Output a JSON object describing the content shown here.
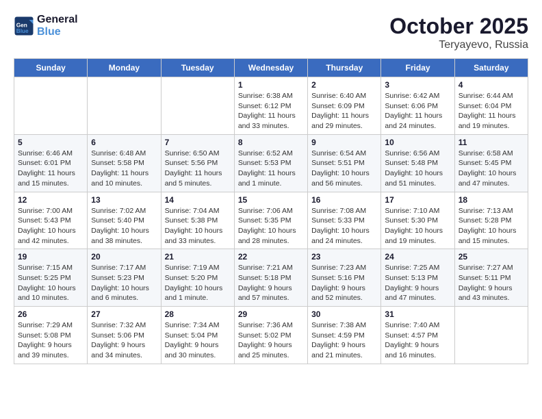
{
  "logo": {
    "line1": "General",
    "line2": "Blue"
  },
  "header": {
    "month": "October 2025",
    "location": "Teryayevo, Russia"
  },
  "weekdays": [
    "Sunday",
    "Monday",
    "Tuesday",
    "Wednesday",
    "Thursday",
    "Friday",
    "Saturday"
  ],
  "weeks": [
    [
      {
        "day": "",
        "info": ""
      },
      {
        "day": "",
        "info": ""
      },
      {
        "day": "",
        "info": ""
      },
      {
        "day": "1",
        "info": "Sunrise: 6:38 AM\nSunset: 6:12 PM\nDaylight: 11 hours\nand 33 minutes."
      },
      {
        "day": "2",
        "info": "Sunrise: 6:40 AM\nSunset: 6:09 PM\nDaylight: 11 hours\nand 29 minutes."
      },
      {
        "day": "3",
        "info": "Sunrise: 6:42 AM\nSunset: 6:06 PM\nDaylight: 11 hours\nand 24 minutes."
      },
      {
        "day": "4",
        "info": "Sunrise: 6:44 AM\nSunset: 6:04 PM\nDaylight: 11 hours\nand 19 minutes."
      }
    ],
    [
      {
        "day": "5",
        "info": "Sunrise: 6:46 AM\nSunset: 6:01 PM\nDaylight: 11 hours\nand 15 minutes."
      },
      {
        "day": "6",
        "info": "Sunrise: 6:48 AM\nSunset: 5:58 PM\nDaylight: 11 hours\nand 10 minutes."
      },
      {
        "day": "7",
        "info": "Sunrise: 6:50 AM\nSunset: 5:56 PM\nDaylight: 11 hours\nand 5 minutes."
      },
      {
        "day": "8",
        "info": "Sunrise: 6:52 AM\nSunset: 5:53 PM\nDaylight: 11 hours\nand 1 minute."
      },
      {
        "day": "9",
        "info": "Sunrise: 6:54 AM\nSunset: 5:51 PM\nDaylight: 10 hours\nand 56 minutes."
      },
      {
        "day": "10",
        "info": "Sunrise: 6:56 AM\nSunset: 5:48 PM\nDaylight: 10 hours\nand 51 minutes."
      },
      {
        "day": "11",
        "info": "Sunrise: 6:58 AM\nSunset: 5:45 PM\nDaylight: 10 hours\nand 47 minutes."
      }
    ],
    [
      {
        "day": "12",
        "info": "Sunrise: 7:00 AM\nSunset: 5:43 PM\nDaylight: 10 hours\nand 42 minutes."
      },
      {
        "day": "13",
        "info": "Sunrise: 7:02 AM\nSunset: 5:40 PM\nDaylight: 10 hours\nand 38 minutes."
      },
      {
        "day": "14",
        "info": "Sunrise: 7:04 AM\nSunset: 5:38 PM\nDaylight: 10 hours\nand 33 minutes."
      },
      {
        "day": "15",
        "info": "Sunrise: 7:06 AM\nSunset: 5:35 PM\nDaylight: 10 hours\nand 28 minutes."
      },
      {
        "day": "16",
        "info": "Sunrise: 7:08 AM\nSunset: 5:33 PM\nDaylight: 10 hours\nand 24 minutes."
      },
      {
        "day": "17",
        "info": "Sunrise: 7:10 AM\nSunset: 5:30 PM\nDaylight: 10 hours\nand 19 minutes."
      },
      {
        "day": "18",
        "info": "Sunrise: 7:13 AM\nSunset: 5:28 PM\nDaylight: 10 hours\nand 15 minutes."
      }
    ],
    [
      {
        "day": "19",
        "info": "Sunrise: 7:15 AM\nSunset: 5:25 PM\nDaylight: 10 hours\nand 10 minutes."
      },
      {
        "day": "20",
        "info": "Sunrise: 7:17 AM\nSunset: 5:23 PM\nDaylight: 10 hours\nand 6 minutes."
      },
      {
        "day": "21",
        "info": "Sunrise: 7:19 AM\nSunset: 5:20 PM\nDaylight: 10 hours\nand 1 minute."
      },
      {
        "day": "22",
        "info": "Sunrise: 7:21 AM\nSunset: 5:18 PM\nDaylight: 9 hours\nand 57 minutes."
      },
      {
        "day": "23",
        "info": "Sunrise: 7:23 AM\nSunset: 5:16 PM\nDaylight: 9 hours\nand 52 minutes."
      },
      {
        "day": "24",
        "info": "Sunrise: 7:25 AM\nSunset: 5:13 PM\nDaylight: 9 hours\nand 47 minutes."
      },
      {
        "day": "25",
        "info": "Sunrise: 7:27 AM\nSunset: 5:11 PM\nDaylight: 9 hours\nand 43 minutes."
      }
    ],
    [
      {
        "day": "26",
        "info": "Sunrise: 7:29 AM\nSunset: 5:08 PM\nDaylight: 9 hours\nand 39 minutes."
      },
      {
        "day": "27",
        "info": "Sunrise: 7:32 AM\nSunset: 5:06 PM\nDaylight: 9 hours\nand 34 minutes."
      },
      {
        "day": "28",
        "info": "Sunrise: 7:34 AM\nSunset: 5:04 PM\nDaylight: 9 hours\nand 30 minutes."
      },
      {
        "day": "29",
        "info": "Sunrise: 7:36 AM\nSunset: 5:02 PM\nDaylight: 9 hours\nand 25 minutes."
      },
      {
        "day": "30",
        "info": "Sunrise: 7:38 AM\nSunset: 4:59 PM\nDaylight: 9 hours\nand 21 minutes."
      },
      {
        "day": "31",
        "info": "Sunrise: 7:40 AM\nSunset: 4:57 PM\nDaylight: 9 hours\nand 16 minutes."
      },
      {
        "day": "",
        "info": ""
      }
    ]
  ]
}
